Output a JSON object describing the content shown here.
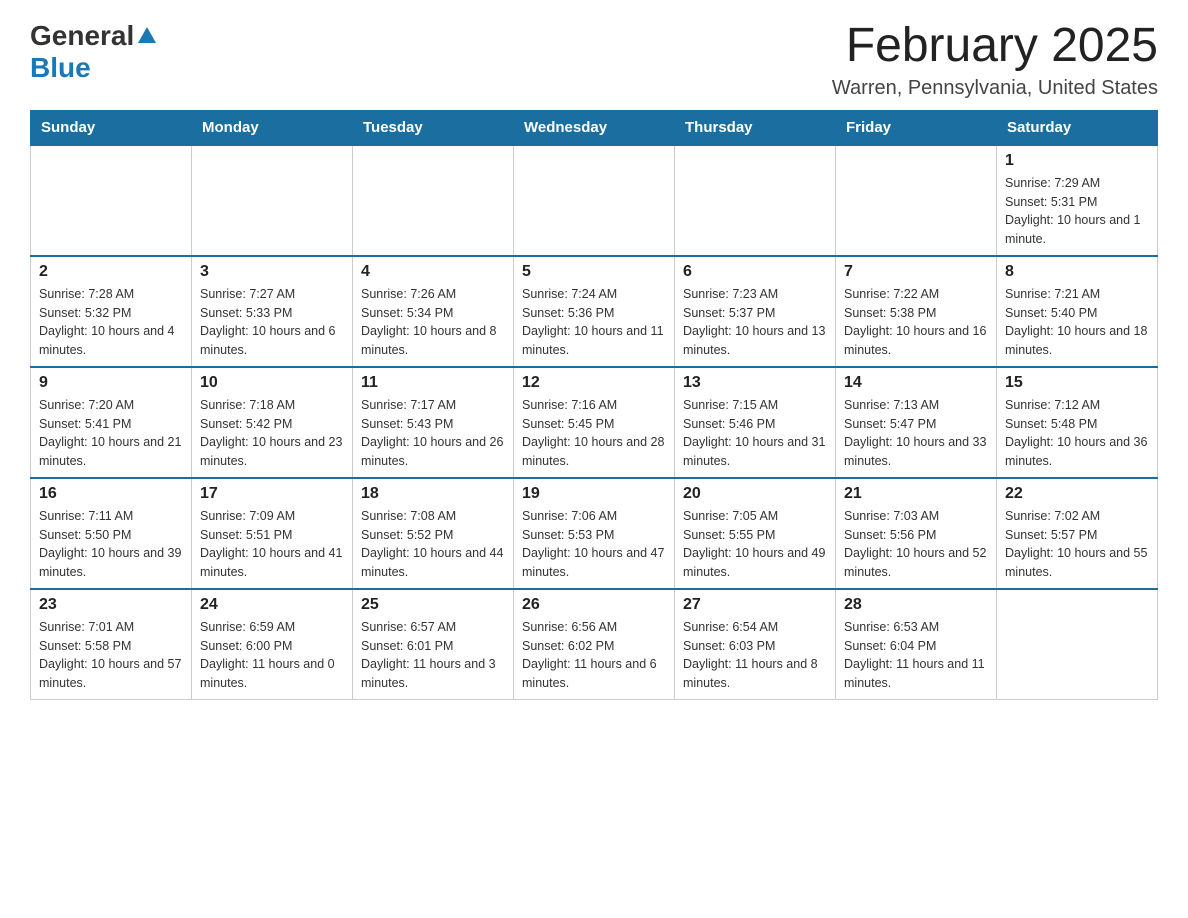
{
  "header": {
    "logo": {
      "general_text": "General",
      "blue_text": "Blue"
    },
    "title": "February 2025",
    "location": "Warren, Pennsylvania, United States"
  },
  "days_of_week": [
    "Sunday",
    "Monday",
    "Tuesday",
    "Wednesday",
    "Thursday",
    "Friday",
    "Saturday"
  ],
  "weeks": [
    [
      {
        "day": "",
        "sunrise": "",
        "sunset": "",
        "daylight": ""
      },
      {
        "day": "",
        "sunrise": "",
        "sunset": "",
        "daylight": ""
      },
      {
        "day": "",
        "sunrise": "",
        "sunset": "",
        "daylight": ""
      },
      {
        "day": "",
        "sunrise": "",
        "sunset": "",
        "daylight": ""
      },
      {
        "day": "",
        "sunrise": "",
        "sunset": "",
        "daylight": ""
      },
      {
        "day": "",
        "sunrise": "",
        "sunset": "",
        "daylight": ""
      },
      {
        "day": "1",
        "sunrise": "Sunrise: 7:29 AM",
        "sunset": "Sunset: 5:31 PM",
        "daylight": "Daylight: 10 hours and 1 minute."
      }
    ],
    [
      {
        "day": "2",
        "sunrise": "Sunrise: 7:28 AM",
        "sunset": "Sunset: 5:32 PM",
        "daylight": "Daylight: 10 hours and 4 minutes."
      },
      {
        "day": "3",
        "sunrise": "Sunrise: 7:27 AM",
        "sunset": "Sunset: 5:33 PM",
        "daylight": "Daylight: 10 hours and 6 minutes."
      },
      {
        "day": "4",
        "sunrise": "Sunrise: 7:26 AM",
        "sunset": "Sunset: 5:34 PM",
        "daylight": "Daylight: 10 hours and 8 minutes."
      },
      {
        "day": "5",
        "sunrise": "Sunrise: 7:24 AM",
        "sunset": "Sunset: 5:36 PM",
        "daylight": "Daylight: 10 hours and 11 minutes."
      },
      {
        "day": "6",
        "sunrise": "Sunrise: 7:23 AM",
        "sunset": "Sunset: 5:37 PM",
        "daylight": "Daylight: 10 hours and 13 minutes."
      },
      {
        "day": "7",
        "sunrise": "Sunrise: 7:22 AM",
        "sunset": "Sunset: 5:38 PM",
        "daylight": "Daylight: 10 hours and 16 minutes."
      },
      {
        "day": "8",
        "sunrise": "Sunrise: 7:21 AM",
        "sunset": "Sunset: 5:40 PM",
        "daylight": "Daylight: 10 hours and 18 minutes."
      }
    ],
    [
      {
        "day": "9",
        "sunrise": "Sunrise: 7:20 AM",
        "sunset": "Sunset: 5:41 PM",
        "daylight": "Daylight: 10 hours and 21 minutes."
      },
      {
        "day": "10",
        "sunrise": "Sunrise: 7:18 AM",
        "sunset": "Sunset: 5:42 PM",
        "daylight": "Daylight: 10 hours and 23 minutes."
      },
      {
        "day": "11",
        "sunrise": "Sunrise: 7:17 AM",
        "sunset": "Sunset: 5:43 PM",
        "daylight": "Daylight: 10 hours and 26 minutes."
      },
      {
        "day": "12",
        "sunrise": "Sunrise: 7:16 AM",
        "sunset": "Sunset: 5:45 PM",
        "daylight": "Daylight: 10 hours and 28 minutes."
      },
      {
        "day": "13",
        "sunrise": "Sunrise: 7:15 AM",
        "sunset": "Sunset: 5:46 PM",
        "daylight": "Daylight: 10 hours and 31 minutes."
      },
      {
        "day": "14",
        "sunrise": "Sunrise: 7:13 AM",
        "sunset": "Sunset: 5:47 PM",
        "daylight": "Daylight: 10 hours and 33 minutes."
      },
      {
        "day": "15",
        "sunrise": "Sunrise: 7:12 AM",
        "sunset": "Sunset: 5:48 PM",
        "daylight": "Daylight: 10 hours and 36 minutes."
      }
    ],
    [
      {
        "day": "16",
        "sunrise": "Sunrise: 7:11 AM",
        "sunset": "Sunset: 5:50 PM",
        "daylight": "Daylight: 10 hours and 39 minutes."
      },
      {
        "day": "17",
        "sunrise": "Sunrise: 7:09 AM",
        "sunset": "Sunset: 5:51 PM",
        "daylight": "Daylight: 10 hours and 41 minutes."
      },
      {
        "day": "18",
        "sunrise": "Sunrise: 7:08 AM",
        "sunset": "Sunset: 5:52 PM",
        "daylight": "Daylight: 10 hours and 44 minutes."
      },
      {
        "day": "19",
        "sunrise": "Sunrise: 7:06 AM",
        "sunset": "Sunset: 5:53 PM",
        "daylight": "Daylight: 10 hours and 47 minutes."
      },
      {
        "day": "20",
        "sunrise": "Sunrise: 7:05 AM",
        "sunset": "Sunset: 5:55 PM",
        "daylight": "Daylight: 10 hours and 49 minutes."
      },
      {
        "day": "21",
        "sunrise": "Sunrise: 7:03 AM",
        "sunset": "Sunset: 5:56 PM",
        "daylight": "Daylight: 10 hours and 52 minutes."
      },
      {
        "day": "22",
        "sunrise": "Sunrise: 7:02 AM",
        "sunset": "Sunset: 5:57 PM",
        "daylight": "Daylight: 10 hours and 55 minutes."
      }
    ],
    [
      {
        "day": "23",
        "sunrise": "Sunrise: 7:01 AM",
        "sunset": "Sunset: 5:58 PM",
        "daylight": "Daylight: 10 hours and 57 minutes."
      },
      {
        "day": "24",
        "sunrise": "Sunrise: 6:59 AM",
        "sunset": "Sunset: 6:00 PM",
        "daylight": "Daylight: 11 hours and 0 minutes."
      },
      {
        "day": "25",
        "sunrise": "Sunrise: 6:57 AM",
        "sunset": "Sunset: 6:01 PM",
        "daylight": "Daylight: 11 hours and 3 minutes."
      },
      {
        "day": "26",
        "sunrise": "Sunrise: 6:56 AM",
        "sunset": "Sunset: 6:02 PM",
        "daylight": "Daylight: 11 hours and 6 minutes."
      },
      {
        "day": "27",
        "sunrise": "Sunrise: 6:54 AM",
        "sunset": "Sunset: 6:03 PM",
        "daylight": "Daylight: 11 hours and 8 minutes."
      },
      {
        "day": "28",
        "sunrise": "Sunrise: 6:53 AM",
        "sunset": "Sunset: 6:04 PM",
        "daylight": "Daylight: 11 hours and 11 minutes."
      },
      {
        "day": "",
        "sunrise": "",
        "sunset": "",
        "daylight": ""
      }
    ]
  ]
}
